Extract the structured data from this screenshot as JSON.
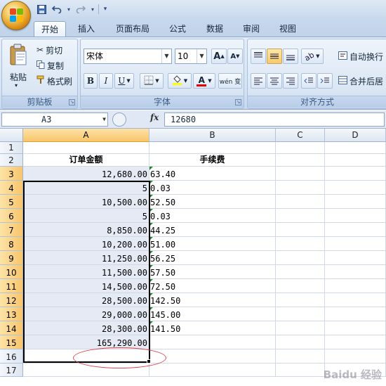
{
  "qat": {
    "save": "save-icon",
    "undo": "undo-icon",
    "redo": "redo-icon",
    "customize": "▾"
  },
  "tabs": [
    {
      "label": "开始",
      "active": true
    },
    {
      "label": "插入",
      "active": false
    },
    {
      "label": "页面布局",
      "active": false
    },
    {
      "label": "公式",
      "active": false
    },
    {
      "label": "数据",
      "active": false
    },
    {
      "label": "审阅",
      "active": false
    },
    {
      "label": "视图",
      "active": false
    }
  ],
  "clipboard": {
    "paste": "粘贴",
    "cut": "剪切",
    "copy": "复制",
    "format_painter": "格式刷",
    "group_label": "剪贴板"
  },
  "font": {
    "name": "宋体",
    "size": "10",
    "grow": "A",
    "shrink": "A",
    "bold": "B",
    "italic": "I",
    "underline": "U",
    "font_color": "A",
    "phonetic": "wén 变",
    "group_label": "字体"
  },
  "alignment": {
    "wrap_text": "自动换行",
    "merge": "合并后居",
    "group_label": "对齐方式"
  },
  "formula_bar": {
    "name_box": "A3",
    "fx": "fx",
    "value": "12680"
  },
  "columns": [
    "A",
    "B",
    "C",
    "D"
  ],
  "rows": [
    "1",
    "2",
    "3",
    "4",
    "5",
    "6",
    "7",
    "8",
    "9",
    "10",
    "11",
    "12",
    "13",
    "14",
    "15",
    "16",
    "17"
  ],
  "headers": {
    "A": "订单金额",
    "B": "手续费"
  },
  "data_rows": [
    {
      "a": "12,680.00",
      "b": "63.40"
    },
    {
      "a": "5",
      "b": "0.03"
    },
    {
      "a": "10,500.00",
      "b": "52.50"
    },
    {
      "a": "5",
      "b": "0.03"
    },
    {
      "a": "8,850.00",
      "b": "44.25"
    },
    {
      "a": "10,200.00",
      "b": "51.00"
    },
    {
      "a": "11,250.00",
      "b": "56.25"
    },
    {
      "a": "11,500.00",
      "b": "57.50"
    },
    {
      "a": "14,500.00",
      "b": "72.50"
    },
    {
      "a": "28,500.00",
      "b": "142.50"
    },
    {
      "a": "29,000.00",
      "b": "145.00"
    },
    {
      "a": "28,300.00",
      "b": "141.50"
    }
  ],
  "total": "165,290.00",
  "watermark": "Baidu 经验",
  "colors": {
    "selection_header": "#f8c56b",
    "shade": "#e5eaf5",
    "annotation": "#e0454f",
    "error_marker": "#1e8a2e"
  }
}
